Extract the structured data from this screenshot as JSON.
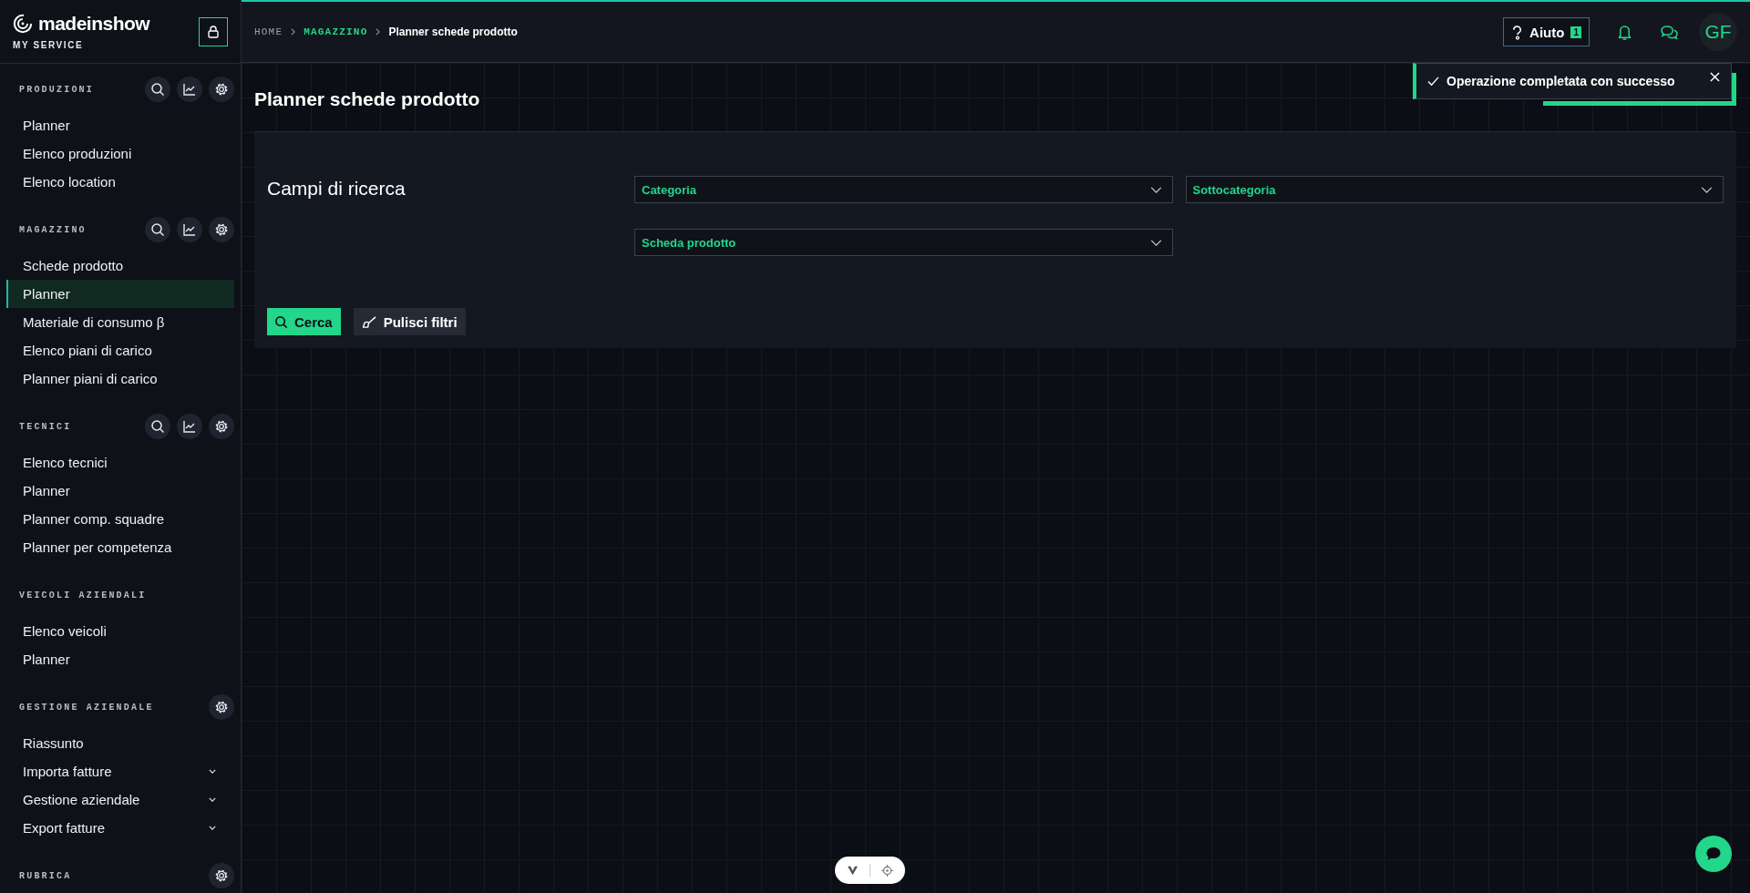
{
  "brand": {
    "name": "madeinshow",
    "subtitle": "MY SERVICE"
  },
  "sidebar": {
    "sections": [
      {
        "title": "PRODUZIONI",
        "tools": [
          {
            "kind": "search"
          },
          {
            "kind": "chart"
          },
          {
            "kind": "settings"
          }
        ],
        "items": [
          {
            "label": "Planner",
            "selected": false,
            "expandable": false
          },
          {
            "label": "Elenco produzioni",
            "selected": false,
            "expandable": false
          },
          {
            "label": "Elenco location",
            "selected": false,
            "expandable": false
          }
        ]
      },
      {
        "title": "MAGAZZINO",
        "tools": [
          {
            "kind": "search"
          },
          {
            "kind": "chart"
          },
          {
            "kind": "settings"
          }
        ],
        "items": [
          {
            "label": "Schede prodotto",
            "selected": false,
            "expandable": false
          },
          {
            "label": "Planner",
            "selected": true,
            "expandable": false
          },
          {
            "label": "Materiale di consumo β",
            "selected": false,
            "expandable": false
          },
          {
            "label": "Elenco piani di carico",
            "selected": false,
            "expandable": false
          },
          {
            "label": "Planner piani di carico",
            "selected": false,
            "expandable": false
          }
        ]
      },
      {
        "title": "TECNICI",
        "tools": [
          {
            "kind": "search"
          },
          {
            "kind": "chart"
          },
          {
            "kind": "settings"
          }
        ],
        "items": [
          {
            "label": "Elenco tecnici",
            "selected": false,
            "expandable": false
          },
          {
            "label": "Planner",
            "selected": false,
            "expandable": false
          },
          {
            "label": "Planner comp. squadre",
            "selected": false,
            "expandable": false
          },
          {
            "label": "Planner per competenza",
            "selected": false,
            "expandable": false
          }
        ]
      },
      {
        "title": "VEICOLI AZIENDALI",
        "items": [
          {
            "label": "Elenco veicoli",
            "selected": false,
            "expandable": false
          },
          {
            "label": "Planner",
            "selected": false,
            "expandable": false
          }
        ]
      },
      {
        "title": "GESTIONE AZIENDALE",
        "tools": [
          {
            "kind": "settings"
          }
        ],
        "items": [
          {
            "label": "Riassunto",
            "selected": false,
            "expandable": false
          },
          {
            "label": "Importa fatture",
            "selected": false,
            "expandable": true
          },
          {
            "label": "Gestione aziendale",
            "selected": false,
            "expandable": true
          },
          {
            "label": "Export fatture",
            "selected": false,
            "expandable": true
          }
        ]
      },
      {
        "title": "RUBRICA",
        "tools": [
          {
            "kind": "settings"
          }
        ]
      }
    ]
  },
  "breadcrumb": [
    {
      "label": "HOME",
      "kind": "root"
    },
    {
      "label": "MAGAZZINO",
      "kind": "link"
    },
    {
      "label": "Planner schede prodotto",
      "kind": "current"
    }
  ],
  "header": {
    "help": {
      "label": "Aiuto",
      "badge": "1"
    },
    "avatar": "GF"
  },
  "toast": {
    "message": "Operazione completata con successo"
  },
  "page": {
    "title": "Planner schede prodotto"
  },
  "search_panel": {
    "title": "Campi di ricerca",
    "fields": [
      {
        "placeholder": "Categoria"
      },
      {
        "placeholder": "Sottocategoria"
      },
      {
        "placeholder": "Scheda prodotto"
      }
    ],
    "buttons": [
      {
        "label": "Cerca",
        "kind": "primary"
      },
      {
        "label": "Pulisci filtri",
        "kind": "secondary"
      }
    ]
  }
}
